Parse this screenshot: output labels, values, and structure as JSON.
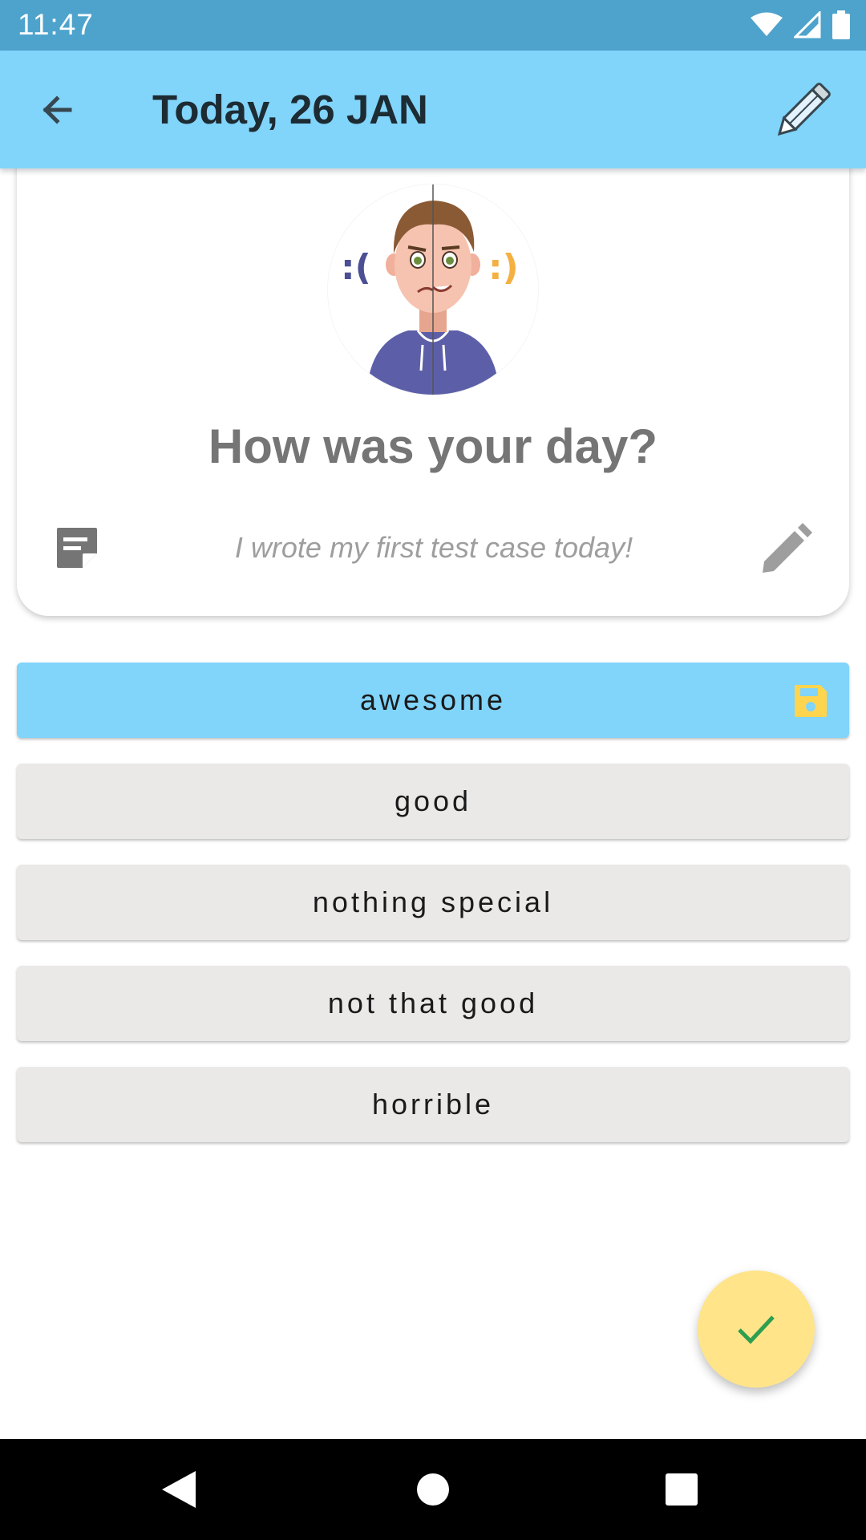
{
  "status_bar": {
    "time": "11:47",
    "icons": [
      "wifi-icon",
      "cell-signal-icon",
      "battery-icon"
    ]
  },
  "app_bar": {
    "title": "Today, 26 JAN",
    "back_icon": "arrow-back-icon",
    "edit_icon": "pencil-icon"
  },
  "card": {
    "question": "How was your day?",
    "note": "I wrote my first test case today!",
    "note_icon": "note-icon",
    "note_edit_icon": "edit-icon",
    "avatar_left_emoticon": ":(",
    "avatar_right_emoticon": ":)"
  },
  "moods": [
    {
      "label": "awesome",
      "selected": true
    },
    {
      "label": "good",
      "selected": false
    },
    {
      "label": "nothing special",
      "selected": false
    },
    {
      "label": "not that good",
      "selected": false
    },
    {
      "label": "horrible",
      "selected": false
    }
  ],
  "fab": {
    "icon": "check-icon"
  },
  "colors": {
    "status_bar": "#4ea3cc",
    "app_bar": "#81d4fa",
    "selected_mood": "#81d4fa",
    "mood_button": "#ebe8e8",
    "fab": "#ffe48a",
    "check": "#2e9e4f",
    "save_icon": "#ffd54f"
  }
}
